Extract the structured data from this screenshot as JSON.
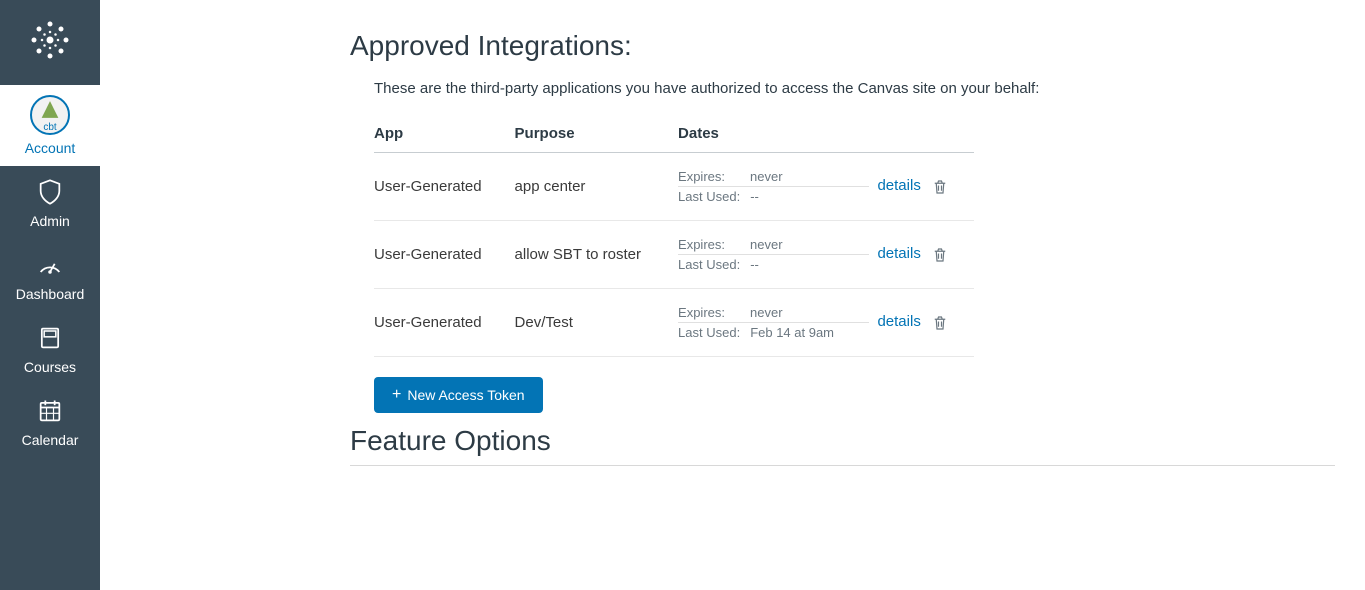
{
  "sidebar": {
    "items": [
      {
        "label": "Account",
        "icon": "avatar"
      },
      {
        "label": "Admin",
        "icon": "shield"
      },
      {
        "label": "Dashboard",
        "icon": "gauge"
      },
      {
        "label": "Courses",
        "icon": "book"
      },
      {
        "label": "Calendar",
        "icon": "calendar"
      }
    ],
    "avatar_text": "cbt"
  },
  "main": {
    "heading": "Approved Integrations:",
    "description": "These are the third-party applications you have authorized to access the Canvas site on your behalf:",
    "columns": {
      "app": "App",
      "purpose": "Purpose",
      "dates": "Dates"
    },
    "labels": {
      "expires": "Expires:",
      "last_used": "Last Used:",
      "details": "details"
    },
    "rows": [
      {
        "app": "User-Generated",
        "purpose": "app center",
        "expires": "never",
        "last_used": "--"
      },
      {
        "app": "User-Generated",
        "purpose": "allow SBT to roster",
        "expires": "never",
        "last_used": "--"
      },
      {
        "app": "User-Generated",
        "purpose": "Dev/Test",
        "expires": "never",
        "last_used": "Feb 14 at 9am"
      }
    ],
    "new_token_button": "New Access Token",
    "feature_heading": "Feature Options"
  }
}
